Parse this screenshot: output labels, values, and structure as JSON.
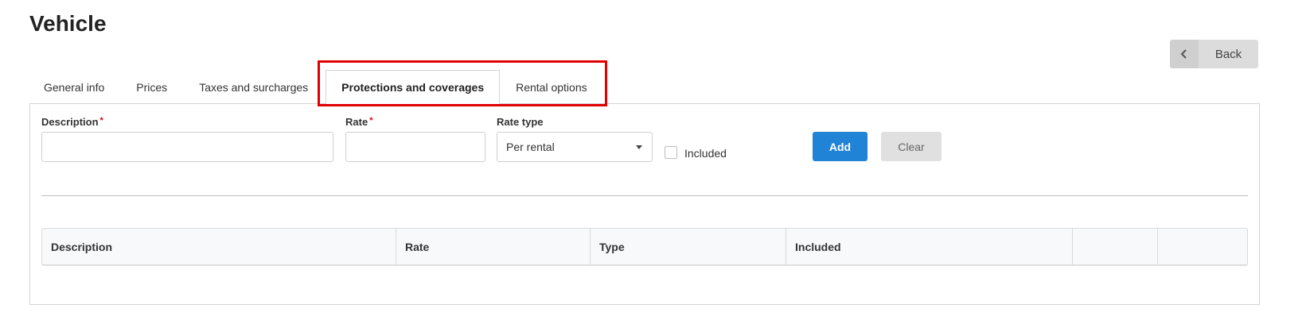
{
  "page": {
    "title": "Vehicle"
  },
  "header": {
    "back_label": "Back",
    "back_icon": "chevron-left-icon"
  },
  "tabs": [
    {
      "label": "General info",
      "active": false
    },
    {
      "label": "Prices",
      "active": false
    },
    {
      "label": "Taxes and surcharges",
      "active": false
    },
    {
      "label": "Protections and coverages",
      "active": true
    },
    {
      "label": "Rental options",
      "active": false
    }
  ],
  "form": {
    "description_label": "Description",
    "description_value": "",
    "rate_label": "Rate",
    "rate_value": "",
    "required_marker": "*",
    "rate_type_label": "Rate type",
    "rate_type_value": "Per rental",
    "included_label": "Included",
    "included_checked": false,
    "add_label": "Add",
    "clear_label": "Clear"
  },
  "table": {
    "columns": [
      "Description",
      "Rate",
      "Type",
      "Included",
      "",
      ""
    ],
    "rows": []
  },
  "colors": {
    "primary": "#2083d6",
    "highlight": "#e00000",
    "required": "#e00000"
  }
}
